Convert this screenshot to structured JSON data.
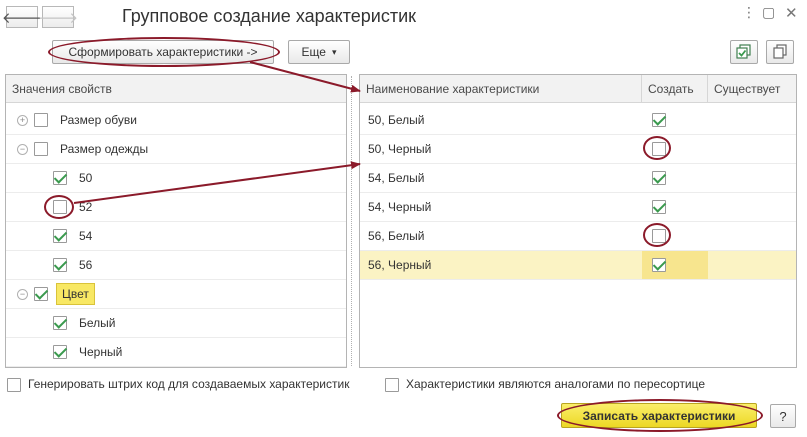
{
  "window": {
    "title": "Групповое создание характеристик",
    "back_icon": "arrow-left-icon",
    "forward_icon": "arrow-right-icon",
    "more_icon": "more-vertical-icon",
    "maximize_icon": "maximize-icon",
    "close_icon": "close-icon"
  },
  "toolbar": {
    "generate_label": "Сформировать характеристики ->",
    "more_label": "Еще",
    "more_chevron": "▾",
    "icon1": "checklist-icon",
    "icon2": "copy-icon"
  },
  "left_panel": {
    "header": "Значения свойств",
    "items": [
      {
        "label": "Размер обуви",
        "level": 0,
        "expander": "+",
        "checked": false
      },
      {
        "label": "Размер одежды",
        "level": 0,
        "expander": "−",
        "checked": false
      },
      {
        "label": "50",
        "level": 1,
        "checked": true
      },
      {
        "label": "52",
        "level": 1,
        "checked": false
      },
      {
        "label": "54",
        "level": 1,
        "checked": true
      },
      {
        "label": "56",
        "level": 1,
        "checked": true
      },
      {
        "label": "Цвет",
        "level": 0,
        "expander": "−",
        "checked": true
      },
      {
        "label": "Белый",
        "level": 1,
        "checked": true
      },
      {
        "label": "Черный",
        "level": 1,
        "checked": true
      }
    ]
  },
  "right_panel": {
    "columns": [
      "Наименование характеристики",
      "Создать",
      "Существует"
    ],
    "rows": [
      {
        "name": "50, Белый",
        "create": true
      },
      {
        "name": "50, Черный",
        "create": false
      },
      {
        "name": "54, Белый",
        "create": true
      },
      {
        "name": "54, Черный",
        "create": true
      },
      {
        "name": "56, Белый",
        "create": false
      },
      {
        "name": "56, Черный",
        "create": true
      }
    ]
  },
  "bottom": {
    "barcode_label": "Генерировать штрих код для создаваемых характеристик",
    "analogs_label": "Характеристики являются аналогами по пересортице",
    "save_label": "Записать характеристики",
    "help_label": "?"
  },
  "colors": {
    "accent_yellow": "#f5e63c",
    "selected_row": "#fbf3c4",
    "annotation": "#8b1a2a",
    "check": "#3a9a4e"
  }
}
